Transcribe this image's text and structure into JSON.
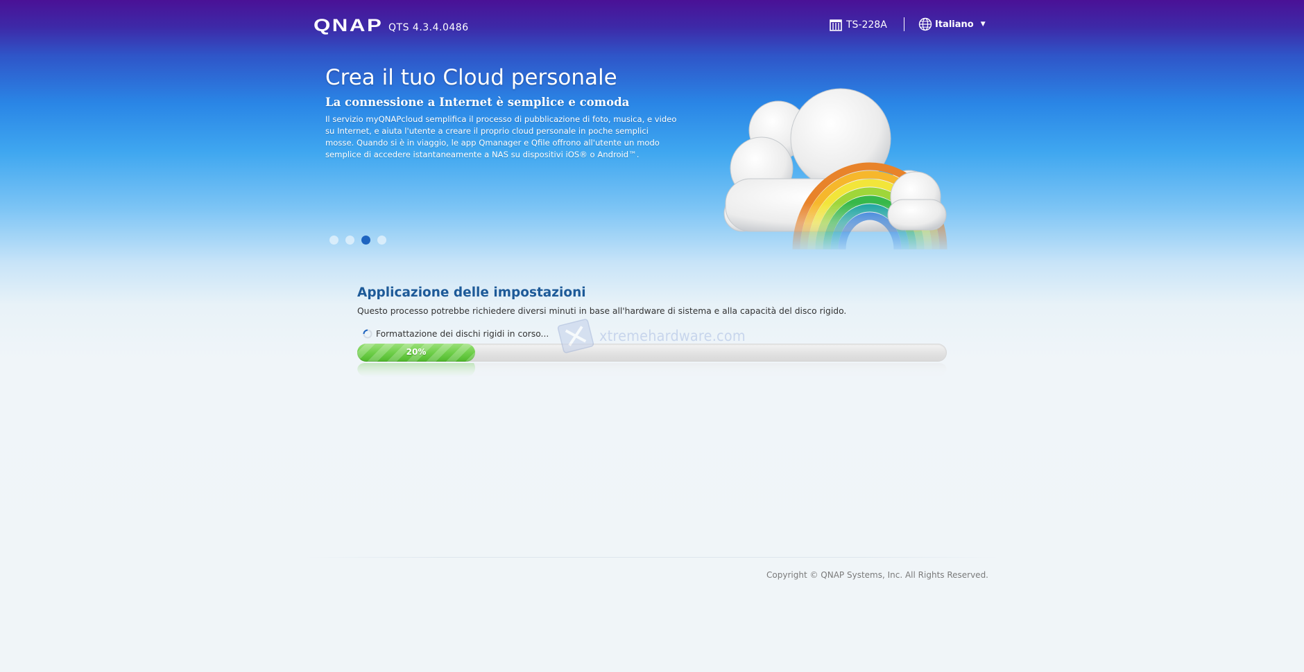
{
  "header": {
    "logo_text": "QNAP",
    "version": "QTS 4.3.4.0486",
    "device_name": "TS-228A",
    "language": "Italiano"
  },
  "banner": {
    "title": "Crea il tuo Cloud personale",
    "subtitle": "La connessione a Internet è semplice e comoda",
    "description": "Il servizio myQNAPcloud semplifica il processo di pubblicazione di foto, musica, e video su Internet, e aiuta l'utente a creare il proprio cloud personale in poche semplici mosse. Quando si è in viaggio, le app Qmanager e Qfile offrono all'utente un modo semplice di accedere istantaneamente a NAS su dispositivi iOS® o Android™.",
    "slides_total": 4,
    "active_slide": 3
  },
  "setup": {
    "title": "Applicazione delle impostazioni",
    "description": "Questo processo potrebbe richiedere diversi minuti in base all'hardware di sistema e alla capacità del disco rigido.",
    "status": "Formattazione dei dischi rigidi in corso...",
    "progress_label": "20%",
    "progress_fraction": 0.2
  },
  "watermark": {
    "text": "xtremehardware.com"
  },
  "footer": {
    "copyright": "Copyright © QNAP Systems, Inc. All Rights Reserved."
  },
  "colors": {
    "header_top": "#4a1196",
    "sky_blue": "#2a86e6",
    "title_blue": "#1d5a98",
    "progress_green": "#6fcf4a",
    "active_dot": "#1e64c0"
  },
  "icons": {
    "device": "nas-device-icon",
    "language": "globe-icon",
    "dropdown": "caret-down-icon",
    "status": "spinner-icon"
  }
}
